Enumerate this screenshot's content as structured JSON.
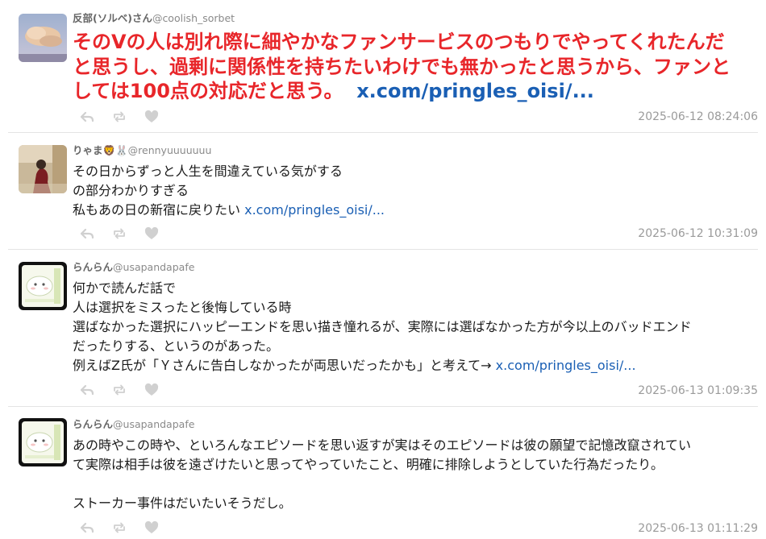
{
  "tweets": [
    {
      "name": "反部(ソルベ)さん",
      "handle": "@coolish_sorbet",
      "lines": [
        "そのVの人は別れ際に細やかなファンサービスのつもりでやってくれたんだ",
        "と思うし、過剰に関係性を持ちたいわけでも無かったと思うから、ファンと",
        "しては100点の対応だと思う。"
      ],
      "link": "x.com/pringles_oisi/...",
      "timestamp": "2025-06-12 08:24:06"
    },
    {
      "name": "りゃま🦁🐰",
      "handle": "@rennyuuuuuuu",
      "lines": [
        "その日からずっと人生を間違えている気がする",
        "の部分わかりすぎる",
        "私もあの日の新宿に戻りたい"
      ],
      "link": "x.com/pringles_oisi/...",
      "timestamp": "2025-06-12 10:31:09"
    },
    {
      "name": "らんらん",
      "handle": "@usapandapafe",
      "lines": [
        "何かで読んだ話で",
        "人は選択をミスったと後悔している時",
        "選ばなかった選択にハッピーエンドを思い描き憧れるが、実際には選ばなかった方が今以上のバッドエンド",
        "だったりする、というのがあった。",
        "例えばZ氏が「Ｙさんに告白しなかったが両思いだったかも」と考えて→"
      ],
      "link": "x.com/pringles_oisi/...",
      "timestamp": "2025-06-13 01:09:35"
    },
    {
      "name": "らんらん",
      "handle": "@usapandapafe",
      "lines": [
        "あの時やこの時や、といろんなエピソードを思い返すが実はそのエピソードは彼の願望で記憶改竄されてい",
        "て実際は相手は彼を遠ざけたいと思ってやっていたこと、明確に排除しようとしていた行為だったり。",
        "",
        "ストーカー事件はだいたいそうだし。"
      ],
      "link": "",
      "timestamp": "2025-06-13 01:11:29"
    }
  ],
  "colors": {
    "highlight_text": "#e8262a",
    "link": "#1a5fb4",
    "meta": "#9a9a9a"
  },
  "icons": [
    "reply-icon",
    "retweet-icon",
    "like-icon"
  ]
}
